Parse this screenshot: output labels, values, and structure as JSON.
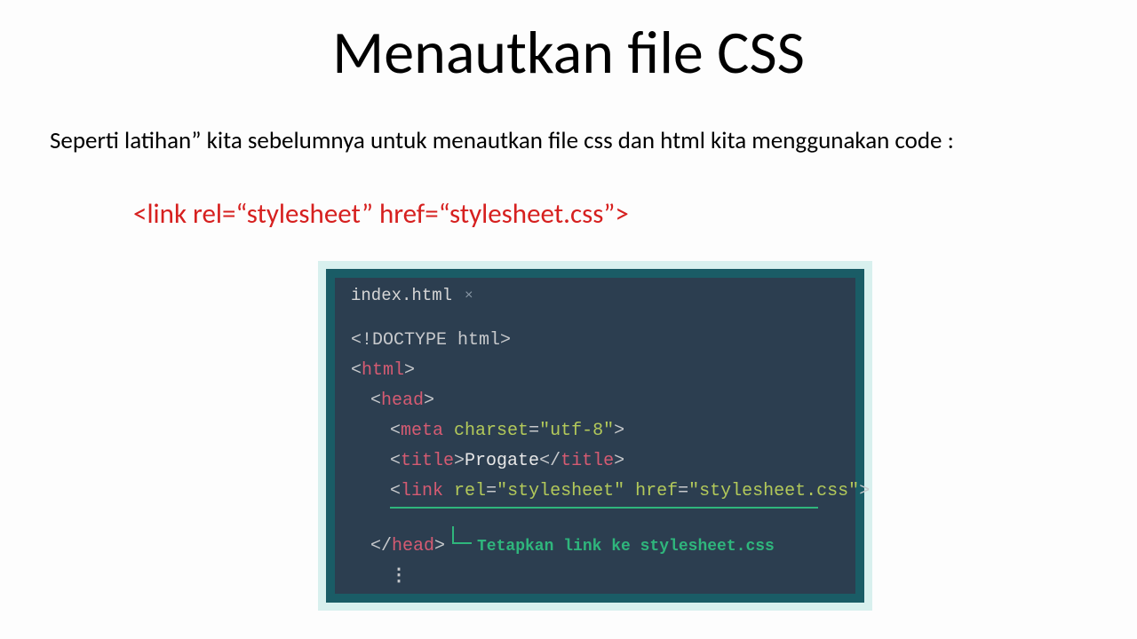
{
  "title": "Menautkan file CSS",
  "intro": "Seperti latihan” kita sebelumnya untuk menautkan file css dan html kita menggunakan code :",
  "code_example": "<link rel=“stylesheet” href=“stylesheet.css”>",
  "editor": {
    "tab": {
      "name": "index.html",
      "close_glyph": "×"
    },
    "lines": {
      "l1_open": "<",
      "l1_doctype": "!DOCTYPE html",
      "l1_close": ">",
      "l2_open": "<",
      "l2_tag": "html",
      "l2_close": ">",
      "l3_open": "<",
      "l3_tag": "head",
      "l3_close": ">",
      "l4_open": "<",
      "l4_tag": "meta",
      "l4_sp": " ",
      "l4_attr": "charset",
      "l4_eq": "=",
      "l4_val": "\"utf-8\"",
      "l4_close": ">",
      "l5_open": "<",
      "l5_tag": "title",
      "l5_close": ">",
      "l5_text": "Progate",
      "l5_open2": "</",
      "l5_tag2": "title",
      "l5_close2": ">",
      "l6_open": "<",
      "l6_tag": "link",
      "l6_sp": " ",
      "l6_a1": "rel",
      "l6_eq1": "=",
      "l6_v1": "\"stylesheet\"",
      "l6_sp2": " ",
      "l6_a2": "href",
      "l6_eq2": "=",
      "l6_v2": "\"stylesheet.css\"",
      "l6_close": ">",
      "l7_open": "</",
      "l7_tag": "head",
      "l7_close": ">",
      "ellipsis": "⋮"
    },
    "callout": "Tetapkan link ke stylesheet.css"
  }
}
